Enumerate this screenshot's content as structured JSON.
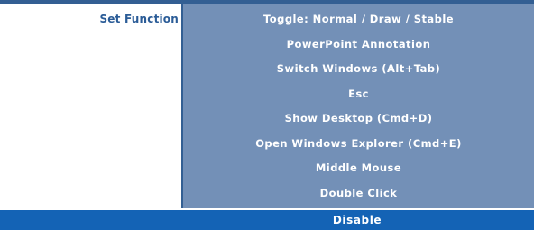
{
  "field": {
    "label": "Set Function"
  },
  "options": [
    {
      "label": "Toggle: Normal / Draw / Stable"
    },
    {
      "label": "PowerPoint Annotation"
    },
    {
      "label": "Switch Windows (Alt+Tab)"
    },
    {
      "label": "Esc"
    },
    {
      "label": "Show Desktop (Cmd+D)"
    },
    {
      "label": "Open Windows Explorer (Cmd+E)"
    },
    {
      "label": "Middle Mouse"
    },
    {
      "label": "Double Click"
    }
  ],
  "selected": {
    "label": "Disable"
  },
  "colors": {
    "panel": "#7390b7",
    "selected_row": "#1463b5",
    "label_text": "#2b5c97",
    "border": "#335f93"
  }
}
